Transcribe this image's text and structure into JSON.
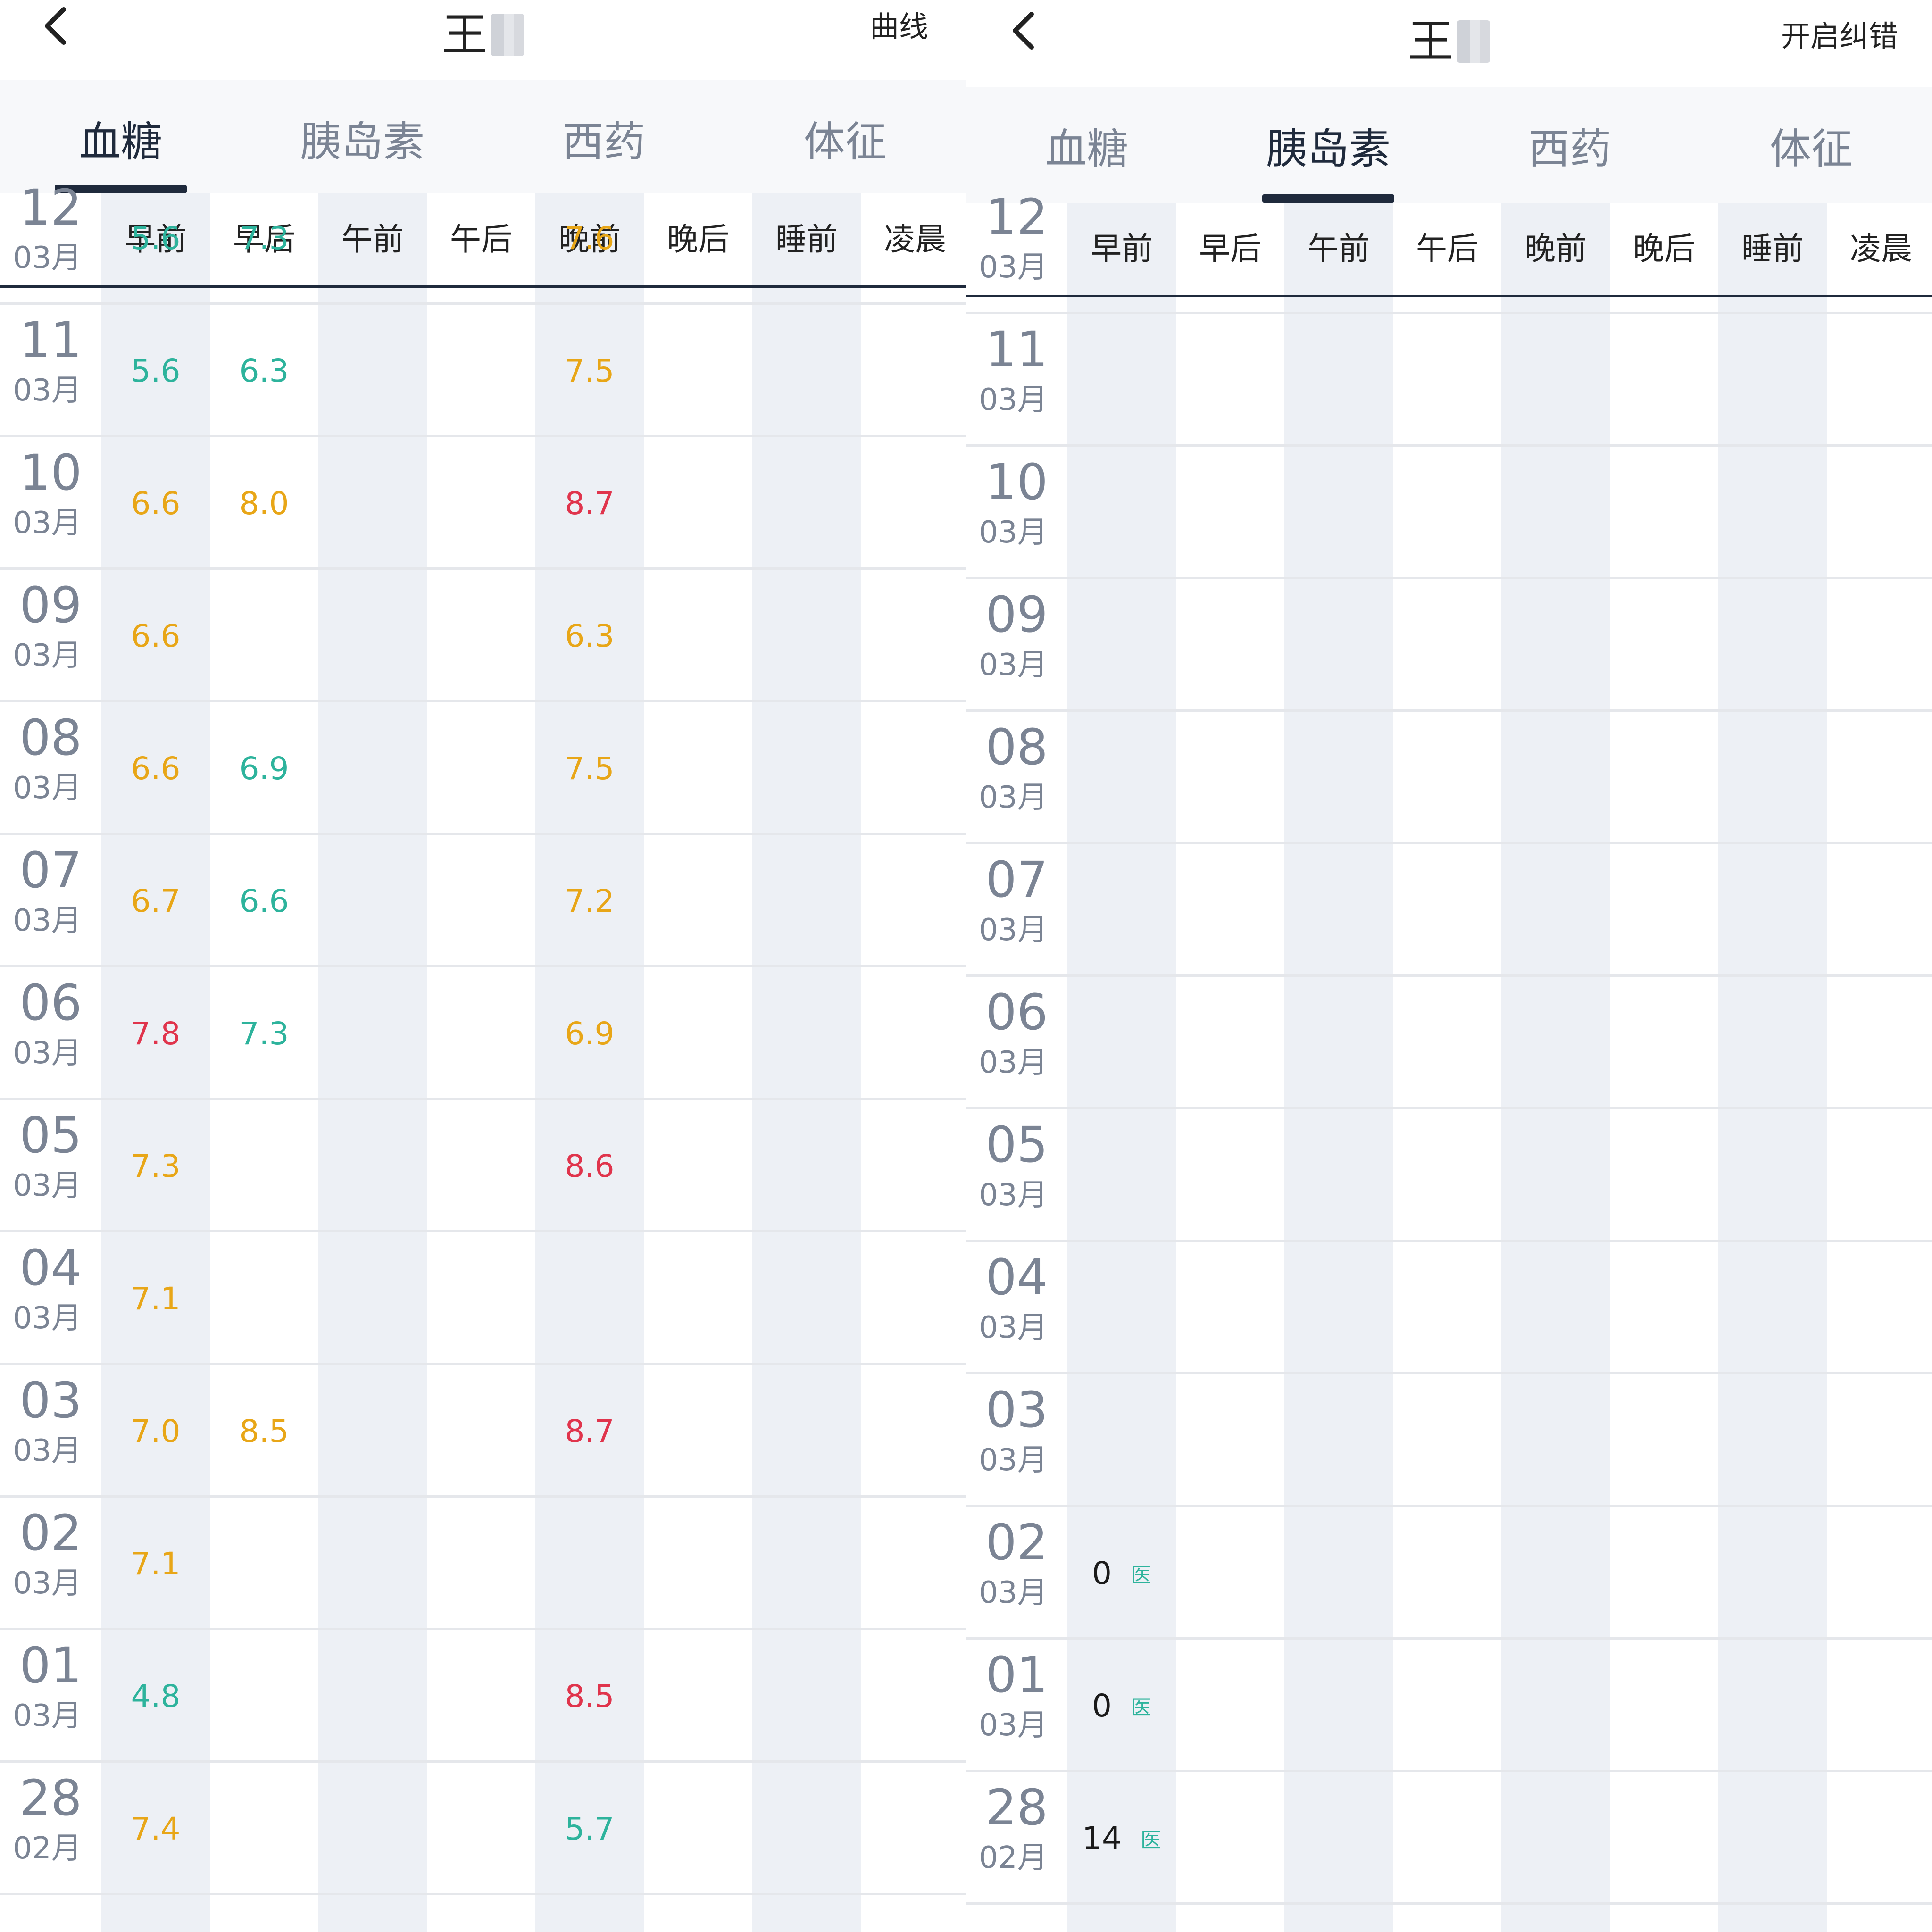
{
  "left": {
    "patient_name": "王",
    "action_label": "曲线",
    "tabs": [
      "血糖",
      "胰岛素",
      "西药",
      "体征"
    ],
    "active_tab": 0,
    "columns": [
      "早前",
      "早后",
      "午前",
      "午后",
      "晚前",
      "晚后",
      "睡前",
      "凌晨"
    ],
    "rows": [
      {
        "day": "12",
        "month": "03月",
        "values": [
          {
            "v": "5.6",
            "c": "green"
          },
          {
            "v": "7.3",
            "c": "green"
          },
          null,
          null,
          {
            "v": "7.6",
            "c": "orange"
          },
          null,
          null,
          null
        ]
      },
      {
        "day": "11",
        "month": "03月",
        "values": [
          {
            "v": "5.6",
            "c": "green"
          },
          {
            "v": "6.3",
            "c": "green"
          },
          null,
          null,
          {
            "v": "7.5",
            "c": "orange"
          },
          null,
          null,
          null
        ]
      },
      {
        "day": "10",
        "month": "03月",
        "values": [
          {
            "v": "6.6",
            "c": "orange"
          },
          {
            "v": "8.0",
            "c": "orange"
          },
          null,
          null,
          {
            "v": "8.7",
            "c": "red"
          },
          null,
          null,
          null
        ]
      },
      {
        "day": "09",
        "month": "03月",
        "values": [
          {
            "v": "6.6",
            "c": "orange"
          },
          null,
          null,
          null,
          {
            "v": "6.3",
            "c": "orange"
          },
          null,
          null,
          null
        ]
      },
      {
        "day": "08",
        "month": "03月",
        "values": [
          {
            "v": "6.6",
            "c": "orange"
          },
          {
            "v": "6.9",
            "c": "green"
          },
          null,
          null,
          {
            "v": "7.5",
            "c": "orange"
          },
          null,
          null,
          null
        ]
      },
      {
        "day": "07",
        "month": "03月",
        "values": [
          {
            "v": "6.7",
            "c": "orange"
          },
          {
            "v": "6.6",
            "c": "green"
          },
          null,
          null,
          {
            "v": "7.2",
            "c": "orange"
          },
          null,
          null,
          null
        ]
      },
      {
        "day": "06",
        "month": "03月",
        "values": [
          {
            "v": "7.8",
            "c": "red"
          },
          {
            "v": "7.3",
            "c": "green"
          },
          null,
          null,
          {
            "v": "6.9",
            "c": "orange"
          },
          null,
          null,
          null
        ]
      },
      {
        "day": "05",
        "month": "03月",
        "values": [
          {
            "v": "7.3",
            "c": "orange"
          },
          null,
          null,
          null,
          {
            "v": "8.6",
            "c": "red"
          },
          null,
          null,
          null
        ]
      },
      {
        "day": "04",
        "month": "03月",
        "values": [
          {
            "v": "7.1",
            "c": "orange"
          },
          null,
          null,
          null,
          null,
          null,
          null,
          null
        ]
      },
      {
        "day": "03",
        "month": "03月",
        "values": [
          {
            "v": "7.0",
            "c": "orange"
          },
          {
            "v": "8.5",
            "c": "orange"
          },
          null,
          null,
          {
            "v": "8.7",
            "c": "red"
          },
          null,
          null,
          null
        ]
      },
      {
        "day": "02",
        "month": "03月",
        "values": [
          {
            "v": "7.1",
            "c": "orange"
          },
          null,
          null,
          null,
          null,
          null,
          null,
          null
        ]
      },
      {
        "day": "01",
        "month": "03月",
        "values": [
          {
            "v": "4.8",
            "c": "green"
          },
          null,
          null,
          null,
          {
            "v": "8.5",
            "c": "red"
          },
          null,
          null,
          null
        ]
      },
      {
        "day": "28",
        "month": "02月",
        "values": [
          {
            "v": "7.4",
            "c": "orange"
          },
          null,
          null,
          null,
          {
            "v": "5.7",
            "c": "green"
          },
          null,
          null,
          null
        ]
      }
    ]
  },
  "right": {
    "patient_name": "王",
    "action_label": "开启纠错",
    "tabs": [
      "血糖",
      "胰岛素",
      "西药",
      "体征"
    ],
    "active_tab": 1,
    "columns": [
      "早前",
      "早后",
      "午前",
      "午后",
      "晚前",
      "晚后",
      "睡前",
      "凌晨"
    ],
    "badge_label": "医",
    "rows": [
      {
        "day": "12",
        "month": "03月",
        "dose": null
      },
      {
        "day": "11",
        "month": "03月",
        "dose": null
      },
      {
        "day": "10",
        "month": "03月",
        "dose": null
      },
      {
        "day": "09",
        "month": "03月",
        "dose": null
      },
      {
        "day": "08",
        "month": "03月",
        "dose": null
      },
      {
        "day": "07",
        "month": "03月",
        "dose": null
      },
      {
        "day": "06",
        "month": "03月",
        "dose": null
      },
      {
        "day": "05",
        "month": "03月",
        "dose": null
      },
      {
        "day": "04",
        "month": "03月",
        "dose": null
      },
      {
        "day": "03",
        "month": "03月",
        "dose": null
      },
      {
        "day": "02",
        "month": "03月",
        "dose": "0"
      },
      {
        "day": "01",
        "month": "03月",
        "dose": "0"
      },
      {
        "day": "28",
        "month": "02月",
        "dose": "14"
      }
    ]
  },
  "colors": {
    "normal": "#2db39c",
    "elevated": "#e8a617",
    "high": "#e0344c",
    "accent": "#1f2a3c"
  }
}
